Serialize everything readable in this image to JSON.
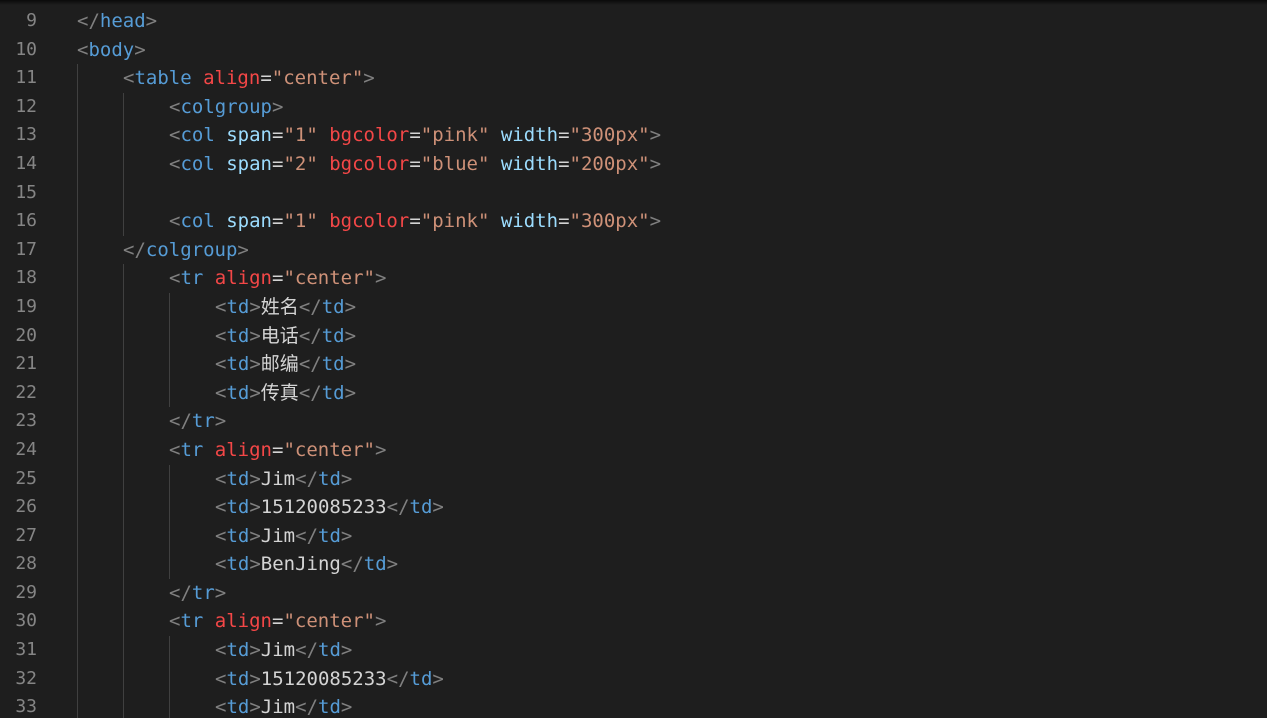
{
  "editor": {
    "language": "html",
    "colors": {
      "background": "#1e1e1e",
      "line_number": "#858585",
      "bracket": "#808080",
      "tag": "#569cd6",
      "attr_red": "#f44747",
      "attr_blue": "#9cdcfe",
      "string": "#ce9178",
      "text": "#d4d4d4"
    },
    "lines": [
      {
        "number": "9",
        "indent": 1,
        "tokens": [
          {
            "type": "bracket",
            "text": "</"
          },
          {
            "type": "tag",
            "text": "head"
          },
          {
            "type": "bracket",
            "text": ">"
          }
        ]
      },
      {
        "number": "10",
        "indent": 1,
        "tokens": [
          {
            "type": "bracket",
            "text": "<"
          },
          {
            "type": "tag",
            "text": "body"
          },
          {
            "type": "bracket",
            "text": ">"
          }
        ]
      },
      {
        "number": "11",
        "indent": 2,
        "tokens": [
          {
            "type": "bracket",
            "text": "<"
          },
          {
            "type": "tag",
            "text": "table"
          },
          {
            "type": "text",
            "text": " "
          },
          {
            "type": "attr_red",
            "text": "align"
          },
          {
            "type": "eq",
            "text": "="
          },
          {
            "type": "string",
            "text": "\"center\""
          },
          {
            "type": "bracket",
            "text": ">"
          }
        ]
      },
      {
        "number": "12",
        "indent": 3,
        "tokens": [
          {
            "type": "bracket",
            "text": "<"
          },
          {
            "type": "tag",
            "text": "colgroup"
          },
          {
            "type": "bracket",
            "text": ">"
          }
        ]
      },
      {
        "number": "13",
        "indent": 3,
        "tokens": [
          {
            "type": "bracket",
            "text": "<"
          },
          {
            "type": "tag",
            "text": "col"
          },
          {
            "type": "text",
            "text": " "
          },
          {
            "type": "attr_blue",
            "text": "span"
          },
          {
            "type": "eq",
            "text": "="
          },
          {
            "type": "string",
            "text": "\"1\""
          },
          {
            "type": "text",
            "text": " "
          },
          {
            "type": "attr_red",
            "text": "bgcolor"
          },
          {
            "type": "eq",
            "text": "="
          },
          {
            "type": "string",
            "text": "\"pink\""
          },
          {
            "type": "text",
            "text": " "
          },
          {
            "type": "attr_blue",
            "text": "width"
          },
          {
            "type": "eq",
            "text": "="
          },
          {
            "type": "string",
            "text": "\"300px\""
          },
          {
            "type": "bracket",
            "text": ">"
          }
        ]
      },
      {
        "number": "14",
        "indent": 3,
        "tokens": [
          {
            "type": "bracket",
            "text": "<"
          },
          {
            "type": "tag",
            "text": "col"
          },
          {
            "type": "text",
            "text": " "
          },
          {
            "type": "attr_blue",
            "text": "span"
          },
          {
            "type": "eq",
            "text": "="
          },
          {
            "type": "string",
            "text": "\"2\""
          },
          {
            "type": "text",
            "text": " "
          },
          {
            "type": "attr_red",
            "text": "bgcolor"
          },
          {
            "type": "eq",
            "text": "="
          },
          {
            "type": "string",
            "text": "\"blue\""
          },
          {
            "type": "text",
            "text": " "
          },
          {
            "type": "attr_blue",
            "text": "width"
          },
          {
            "type": "eq",
            "text": "="
          },
          {
            "type": "string",
            "text": "\"200px\""
          },
          {
            "type": "bracket",
            "text": ">"
          }
        ]
      },
      {
        "number": "15",
        "indent": 3,
        "tokens": []
      },
      {
        "number": "16",
        "indent": 3,
        "tokens": [
          {
            "type": "bracket",
            "text": "<"
          },
          {
            "type": "tag",
            "text": "col"
          },
          {
            "type": "text",
            "text": " "
          },
          {
            "type": "attr_blue",
            "text": "span"
          },
          {
            "type": "eq",
            "text": "="
          },
          {
            "type": "string",
            "text": "\"1\""
          },
          {
            "type": "text",
            "text": " "
          },
          {
            "type": "attr_red",
            "text": "bgcolor"
          },
          {
            "type": "eq",
            "text": "="
          },
          {
            "type": "string",
            "text": "\"pink\""
          },
          {
            "type": "text",
            "text": " "
          },
          {
            "type": "attr_blue",
            "text": "width"
          },
          {
            "type": "eq",
            "text": "="
          },
          {
            "type": "string",
            "text": "\"300px\""
          },
          {
            "type": "bracket",
            "text": ">"
          }
        ]
      },
      {
        "number": "17",
        "indent": 2,
        "tokens": [
          {
            "type": "bracket",
            "text": "</"
          },
          {
            "type": "tag",
            "text": "colgroup"
          },
          {
            "type": "bracket",
            "text": ">"
          }
        ]
      },
      {
        "number": "18",
        "indent": 3,
        "tokens": [
          {
            "type": "bracket",
            "text": "<"
          },
          {
            "type": "tag",
            "text": "tr"
          },
          {
            "type": "text",
            "text": " "
          },
          {
            "type": "attr_red",
            "text": "align"
          },
          {
            "type": "eq",
            "text": "="
          },
          {
            "type": "string",
            "text": "\"center\""
          },
          {
            "type": "bracket",
            "text": ">"
          }
        ]
      },
      {
        "number": "19",
        "indent": 4,
        "tokens": [
          {
            "type": "bracket",
            "text": "<"
          },
          {
            "type": "tag",
            "text": "td"
          },
          {
            "type": "bracket",
            "text": ">"
          },
          {
            "type": "text",
            "text": "姓名"
          },
          {
            "type": "bracket",
            "text": "</"
          },
          {
            "type": "tag",
            "text": "td"
          },
          {
            "type": "bracket",
            "text": ">"
          }
        ]
      },
      {
        "number": "20",
        "indent": 4,
        "tokens": [
          {
            "type": "bracket",
            "text": "<"
          },
          {
            "type": "tag",
            "text": "td"
          },
          {
            "type": "bracket",
            "text": ">"
          },
          {
            "type": "text",
            "text": "电话"
          },
          {
            "type": "bracket",
            "text": "</"
          },
          {
            "type": "tag",
            "text": "td"
          },
          {
            "type": "bracket",
            "text": ">"
          }
        ]
      },
      {
        "number": "21",
        "indent": 4,
        "tokens": [
          {
            "type": "bracket",
            "text": "<"
          },
          {
            "type": "tag",
            "text": "td"
          },
          {
            "type": "bracket",
            "text": ">"
          },
          {
            "type": "text",
            "text": "邮编"
          },
          {
            "type": "bracket",
            "text": "</"
          },
          {
            "type": "tag",
            "text": "td"
          },
          {
            "type": "bracket",
            "text": ">"
          }
        ]
      },
      {
        "number": "22",
        "indent": 4,
        "tokens": [
          {
            "type": "bracket",
            "text": "<"
          },
          {
            "type": "tag",
            "text": "td"
          },
          {
            "type": "bracket",
            "text": ">"
          },
          {
            "type": "text",
            "text": "传真"
          },
          {
            "type": "bracket",
            "text": "</"
          },
          {
            "type": "tag",
            "text": "td"
          },
          {
            "type": "bracket",
            "text": ">"
          }
        ]
      },
      {
        "number": "23",
        "indent": 3,
        "tokens": [
          {
            "type": "bracket",
            "text": "</"
          },
          {
            "type": "tag",
            "text": "tr"
          },
          {
            "type": "bracket",
            "text": ">"
          }
        ]
      },
      {
        "number": "24",
        "indent": 3,
        "tokens": [
          {
            "type": "bracket",
            "text": "<"
          },
          {
            "type": "tag",
            "text": "tr"
          },
          {
            "type": "text",
            "text": " "
          },
          {
            "type": "attr_red",
            "text": "align"
          },
          {
            "type": "eq",
            "text": "="
          },
          {
            "type": "string",
            "text": "\"center\""
          },
          {
            "type": "bracket",
            "text": ">"
          }
        ]
      },
      {
        "number": "25",
        "indent": 4,
        "tokens": [
          {
            "type": "bracket",
            "text": "<"
          },
          {
            "type": "tag",
            "text": "td"
          },
          {
            "type": "bracket",
            "text": ">"
          },
          {
            "type": "text",
            "text": "Jim"
          },
          {
            "type": "bracket",
            "text": "</"
          },
          {
            "type": "tag",
            "text": "td"
          },
          {
            "type": "bracket",
            "text": ">"
          }
        ]
      },
      {
        "number": "26",
        "indent": 4,
        "tokens": [
          {
            "type": "bracket",
            "text": "<"
          },
          {
            "type": "tag",
            "text": "td"
          },
          {
            "type": "bracket",
            "text": ">"
          },
          {
            "type": "text",
            "text": "15120085233"
          },
          {
            "type": "bracket",
            "text": "</"
          },
          {
            "type": "tag",
            "text": "td"
          },
          {
            "type": "bracket",
            "text": ">"
          }
        ]
      },
      {
        "number": "27",
        "indent": 4,
        "tokens": [
          {
            "type": "bracket",
            "text": "<"
          },
          {
            "type": "tag",
            "text": "td"
          },
          {
            "type": "bracket",
            "text": ">"
          },
          {
            "type": "text",
            "text": "Jim"
          },
          {
            "type": "bracket",
            "text": "</"
          },
          {
            "type": "tag",
            "text": "td"
          },
          {
            "type": "bracket",
            "text": ">"
          }
        ]
      },
      {
        "number": "28",
        "indent": 4,
        "tokens": [
          {
            "type": "bracket",
            "text": "<"
          },
          {
            "type": "tag",
            "text": "td"
          },
          {
            "type": "bracket",
            "text": ">"
          },
          {
            "type": "text",
            "text": "BenJing"
          },
          {
            "type": "bracket",
            "text": "</"
          },
          {
            "type": "tag",
            "text": "td"
          },
          {
            "type": "bracket",
            "text": ">"
          }
        ]
      },
      {
        "number": "29",
        "indent": 3,
        "tokens": [
          {
            "type": "bracket",
            "text": "</"
          },
          {
            "type": "tag",
            "text": "tr"
          },
          {
            "type": "bracket",
            "text": ">"
          }
        ]
      },
      {
        "number": "30",
        "indent": 3,
        "tokens": [
          {
            "type": "bracket",
            "text": "<"
          },
          {
            "type": "tag",
            "text": "tr"
          },
          {
            "type": "text",
            "text": " "
          },
          {
            "type": "attr_red",
            "text": "align"
          },
          {
            "type": "eq",
            "text": "="
          },
          {
            "type": "string",
            "text": "\"center\""
          },
          {
            "type": "bracket",
            "text": ">"
          }
        ]
      },
      {
        "number": "31",
        "indent": 4,
        "tokens": [
          {
            "type": "bracket",
            "text": "<"
          },
          {
            "type": "tag",
            "text": "td"
          },
          {
            "type": "bracket",
            "text": ">"
          },
          {
            "type": "text",
            "text": "Jim"
          },
          {
            "type": "bracket",
            "text": "</"
          },
          {
            "type": "tag",
            "text": "td"
          },
          {
            "type": "bracket",
            "text": ">"
          }
        ]
      },
      {
        "number": "32",
        "indent": 4,
        "tokens": [
          {
            "type": "bracket",
            "text": "<"
          },
          {
            "type": "tag",
            "text": "td"
          },
          {
            "type": "bracket",
            "text": ">"
          },
          {
            "type": "text",
            "text": "15120085233"
          },
          {
            "type": "bracket",
            "text": "</"
          },
          {
            "type": "tag",
            "text": "td"
          },
          {
            "type": "bracket",
            "text": ">"
          }
        ]
      },
      {
        "number": "33",
        "indent": 4,
        "tokens": [
          {
            "type": "bracket",
            "text": "<"
          },
          {
            "type": "tag",
            "text": "td"
          },
          {
            "type": "bracket",
            "text": ">"
          },
          {
            "type": "text",
            "text": "Jim"
          },
          {
            "type": "bracket",
            "text": "</"
          },
          {
            "type": "tag",
            "text": "td"
          },
          {
            "type": "bracket",
            "text": ">"
          }
        ]
      }
    ]
  }
}
